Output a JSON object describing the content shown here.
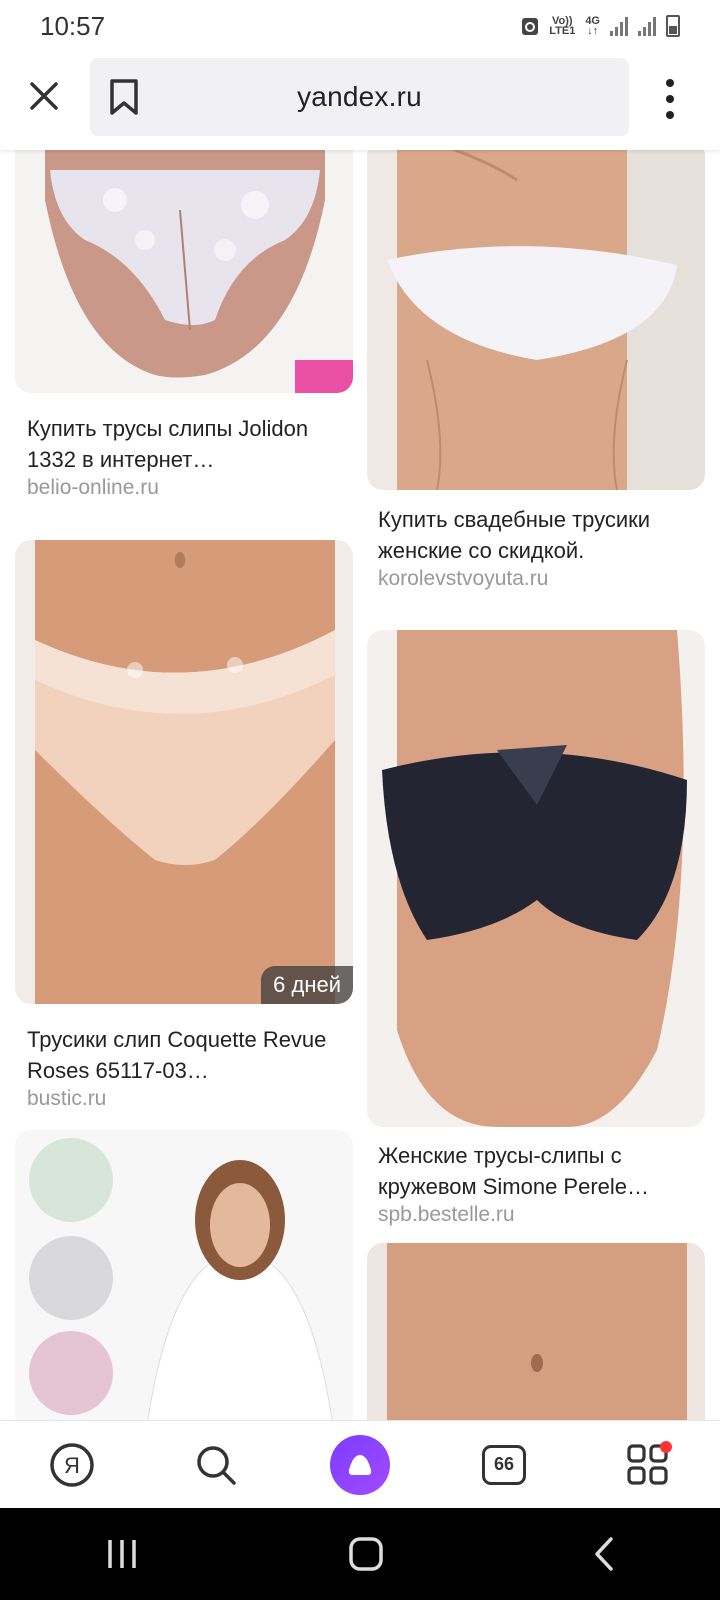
{
  "status_bar": {
    "time": "10:57",
    "volte": "Vo))",
    "lte": "LTE1",
    "network": "4G"
  },
  "address_bar": {
    "url": "yandex.ru"
  },
  "results": [
    {
      "title": "Купить трусы слипы Jolidon 1332 в интернет…",
      "source": "belio-online.ru",
      "badge": ""
    },
    {
      "title": "Купить свадебные трусики женские со скидкой.",
      "source": "korolevstvoyuta.ru",
      "badge": ""
    },
    {
      "title": "Трусики слип Coquette Revue Roses 65117-03…",
      "source": "bustic.ru",
      "badge": "6 дней"
    },
    {
      "title": "Женские трусы-слипы с кружевом Simone Perele…",
      "source": "spb.bestelle.ru",
      "badge": ""
    },
    {
      "title": "",
      "source": "",
      "badge": ""
    },
    {
      "title": "",
      "source": "",
      "badge": ""
    }
  ],
  "bottom_nav": {
    "yandex_letter": "Я",
    "tabs_count": "66"
  },
  "colors": {
    "alice_accent": "#8a3dff",
    "notification": "#ff3333",
    "source_text": "#999999"
  }
}
